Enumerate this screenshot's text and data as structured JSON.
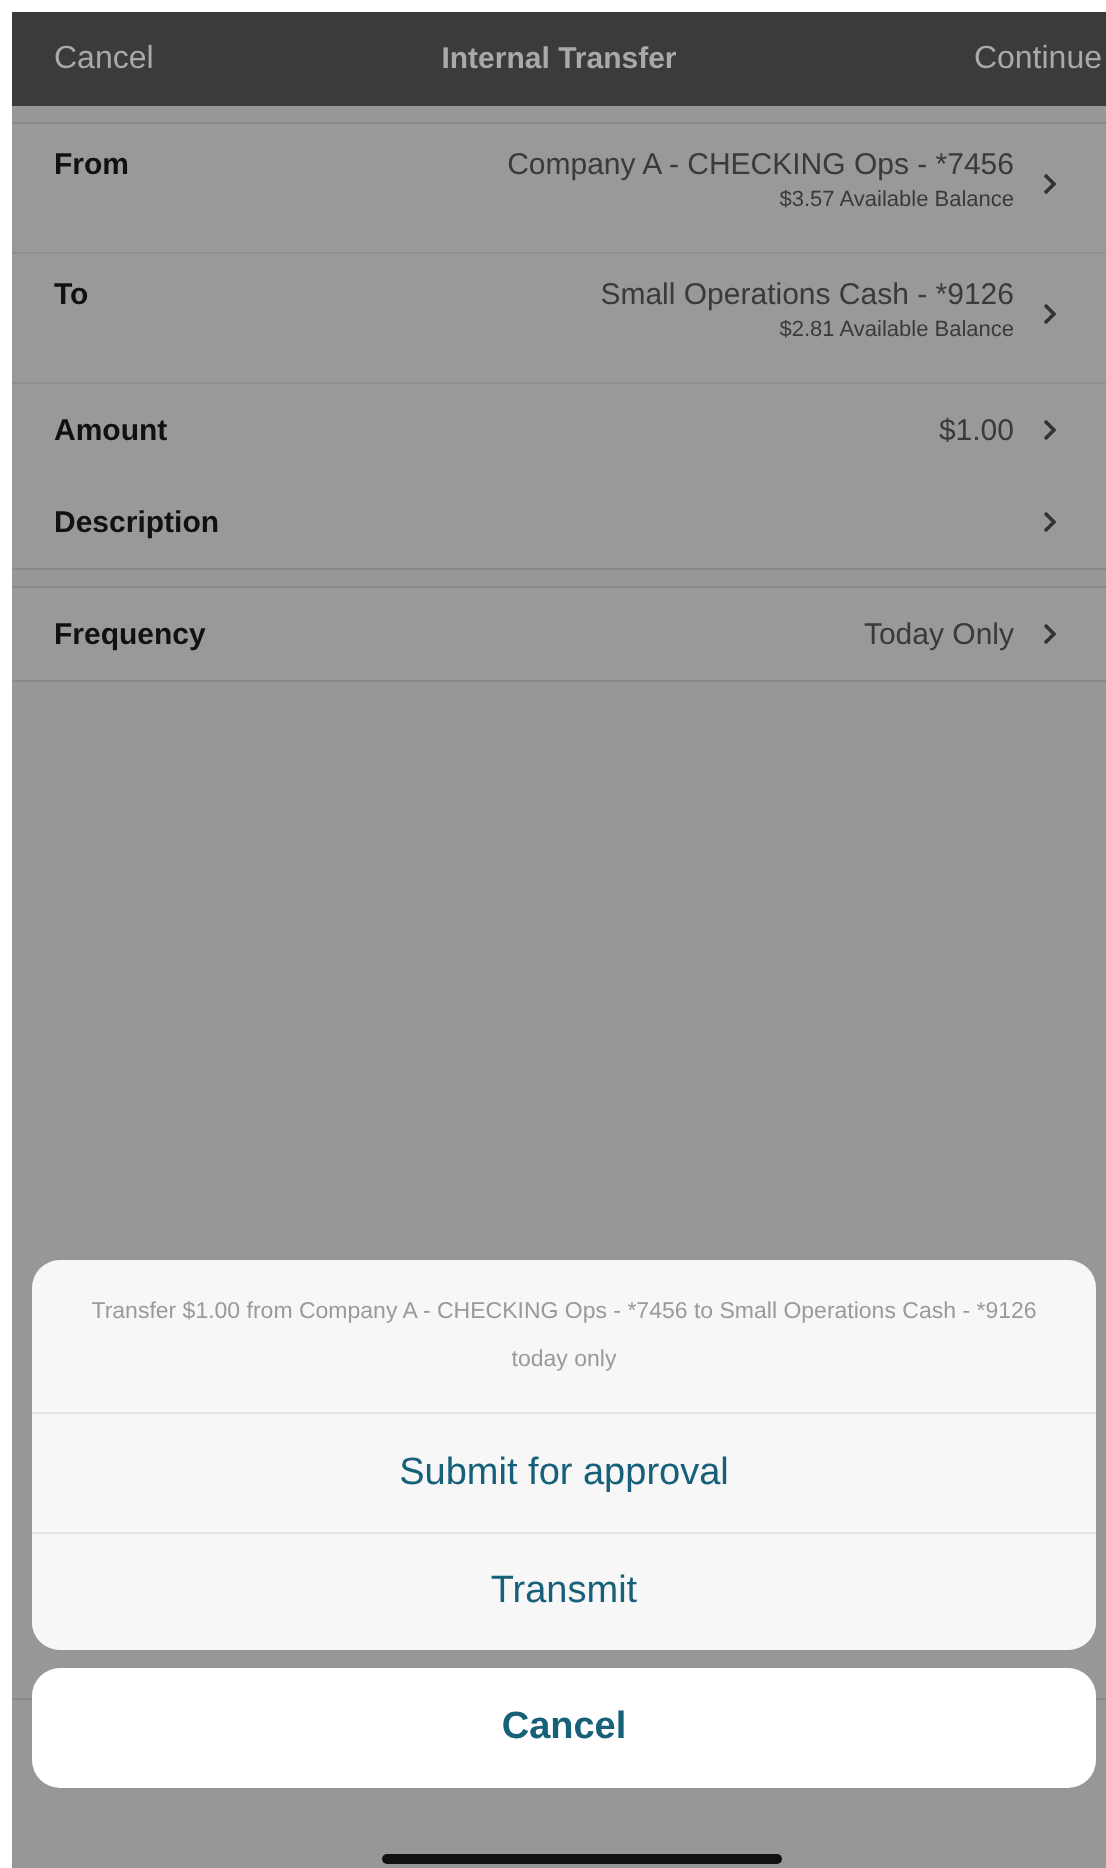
{
  "header": {
    "cancel": "Cancel",
    "title": "Internal Transfer",
    "continue": "Continue"
  },
  "sections": [
    {
      "rows": [
        {
          "label": "From",
          "value": "Company A - CHECKING Ops - *7456",
          "sub": "$3.57 Available Balance"
        },
        {
          "label": "To",
          "value": "Small Operations Cash - *9126",
          "sub": "$2.81 Available Balance"
        },
        {
          "label": "Amount",
          "value": "$1.00"
        },
        {
          "label": "Description"
        }
      ]
    },
    {
      "rows": [
        {
          "label": "Frequency",
          "value": "Today Only"
        }
      ]
    }
  ],
  "action_sheet": {
    "message": "Transfer $1.00 from Company A - CHECKING Ops - *7456 to Small Operations Cash - *9126 today only",
    "actions": [
      "Submit for approval",
      "Transmit"
    ],
    "cancel": "Cancel"
  }
}
